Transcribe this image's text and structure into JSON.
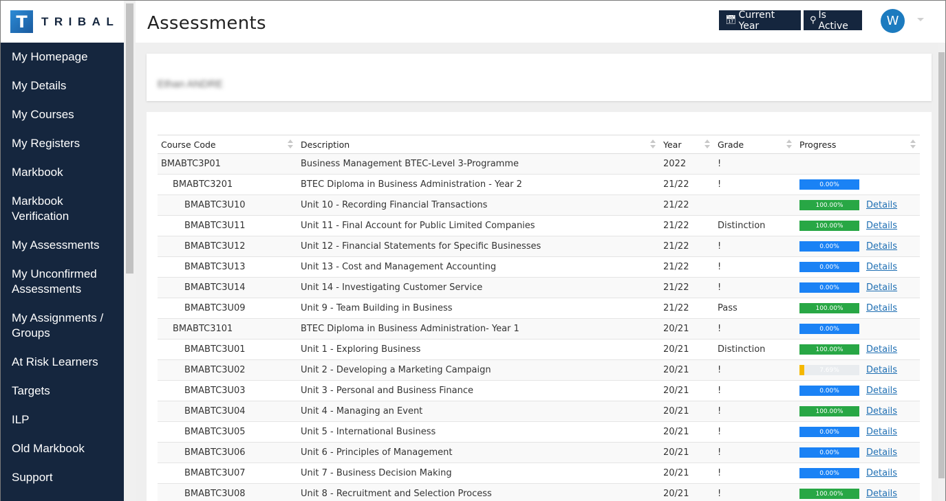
{
  "brand": {
    "mark": "T",
    "name": "TRIBAL"
  },
  "sidebar": {
    "items": [
      {
        "label": "My Homepage"
      },
      {
        "label": "My Details"
      },
      {
        "label": "My Courses"
      },
      {
        "label": "My Registers"
      },
      {
        "label": "Markbook"
      },
      {
        "label": "Markbook Verification"
      },
      {
        "label": "My Assessments"
      },
      {
        "label": "My Unconfirmed Assessments"
      },
      {
        "label": "My Assignments / Groups"
      },
      {
        "label": "At Risk Learners"
      },
      {
        "label": "Targets"
      },
      {
        "label": "ILP"
      },
      {
        "label": "Old Markbook"
      },
      {
        "label": "Support"
      }
    ]
  },
  "header": {
    "title": "Assessments",
    "current_year_label": "Current Year",
    "is_active_label": "Is Active",
    "avatar_initial": "W"
  },
  "learner": {
    "name": "Ethan ANDRE"
  },
  "table": {
    "columns": [
      "Course Code",
      "Description",
      "Year",
      "Grade",
      "Progress"
    ],
    "details_label": "Details",
    "rows": [
      {
        "code": "BMABTC3P01",
        "level": 0,
        "description": "Business Management BTEC-Level 3-Programme",
        "year": "2022",
        "grade": "!",
        "progress": null,
        "details": false
      },
      {
        "code": "BMABTC3201",
        "level": 1,
        "description": "BTEC Diploma in Business Administration - Year 2",
        "year": "21/22",
        "grade": "!",
        "progress": "0.00%",
        "progress_value": 0,
        "color": "#1a82f5",
        "details": false
      },
      {
        "code": "BMABTC3U10",
        "level": 2,
        "description": "Unit 10 - Recording Financial Transactions",
        "year": "21/22",
        "grade": "",
        "progress": "100.00%",
        "progress_value": 100,
        "color": "#28a745",
        "details": true
      },
      {
        "code": "BMABTC3U11",
        "level": 2,
        "description": "Unit 11 - Final Account for Public Limited Companies",
        "year": "21/22",
        "grade": "Distinction",
        "progress": "100.00%",
        "progress_value": 100,
        "color": "#28a745",
        "details": true
      },
      {
        "code": "BMABTC3U12",
        "level": 2,
        "description": "Unit 12 - Financial Statements for Specific Businesses",
        "year": "21/22",
        "grade": "!",
        "progress": "0.00%",
        "progress_value": 0,
        "color": "#1a82f5",
        "details": true
      },
      {
        "code": "BMABTC3U13",
        "level": 2,
        "description": "Unit 13 - Cost and Management Accounting",
        "year": "21/22",
        "grade": "!",
        "progress": "0.00%",
        "progress_value": 0,
        "color": "#1a82f5",
        "details": true
      },
      {
        "code": "BMABTC3U14",
        "level": 2,
        "description": "Unit 14 - Investigating Customer Service",
        "year": "21/22",
        "grade": "!",
        "progress": "0.00%",
        "progress_value": 0,
        "color": "#1a82f5",
        "details": true
      },
      {
        "code": "BMABTC3U09",
        "level": 2,
        "description": "Unit 9 - Team Building in Business",
        "year": "21/22",
        "grade": "Pass",
        "progress": "100.00%",
        "progress_value": 100,
        "color": "#28a745",
        "details": true
      },
      {
        "code": "BMABTC3101",
        "level": 1,
        "description": "BTEC Diploma in Business Administration- Year 1",
        "year": "20/21",
        "grade": "!",
        "progress": "0.00%",
        "progress_value": 0,
        "color": "#1a82f5",
        "details": false
      },
      {
        "code": "BMABTC3U01",
        "level": 2,
        "description": "Unit 1 - Exploring Business",
        "year": "20/21",
        "grade": "Distinction",
        "progress": "100.00%",
        "progress_value": 100,
        "color": "#28a745",
        "details": true
      },
      {
        "code": "BMABTC3U02",
        "level": 2,
        "description": "Unit 2 - Developing a Marketing Campaign",
        "year": "20/21",
        "grade": "!",
        "progress": "7.69%",
        "progress_value": 7.69,
        "color": "#f5b800",
        "details": true
      },
      {
        "code": "BMABTC3U03",
        "level": 2,
        "description": "Unit 3 - Personal and Business Finance",
        "year": "20/21",
        "grade": "!",
        "progress": "0.00%",
        "progress_value": 0,
        "color": "#1a82f5",
        "details": true
      },
      {
        "code": "BMABTC3U04",
        "level": 2,
        "description": "Unit 4 - Managing an Event",
        "year": "20/21",
        "grade": "!",
        "progress": "100.00%",
        "progress_value": 100,
        "color": "#28a745",
        "details": true
      },
      {
        "code": "BMABTC3U05",
        "level": 2,
        "description": "Unit 5 - International Business",
        "year": "20/21",
        "grade": "!",
        "progress": "0.00%",
        "progress_value": 0,
        "color": "#1a82f5",
        "details": true
      },
      {
        "code": "BMABTC3U06",
        "level": 2,
        "description": "Unit 6 - Principles of Management",
        "year": "20/21",
        "grade": "!",
        "progress": "0.00%",
        "progress_value": 0,
        "color": "#1a82f5",
        "details": true
      },
      {
        "code": "BMABTC3U07",
        "level": 2,
        "description": "Unit 7 - Business Decision Making",
        "year": "20/21",
        "grade": "!",
        "progress": "0.00%",
        "progress_value": 0,
        "color": "#1a82f5",
        "details": true
      },
      {
        "code": "BMABTC3U08",
        "level": 2,
        "description": "Unit 8 - Recruitment and Selection Process",
        "year": "20/21",
        "grade": "!",
        "progress": "100.00%",
        "progress_value": 100,
        "color": "#28a745",
        "details": true
      }
    ]
  }
}
